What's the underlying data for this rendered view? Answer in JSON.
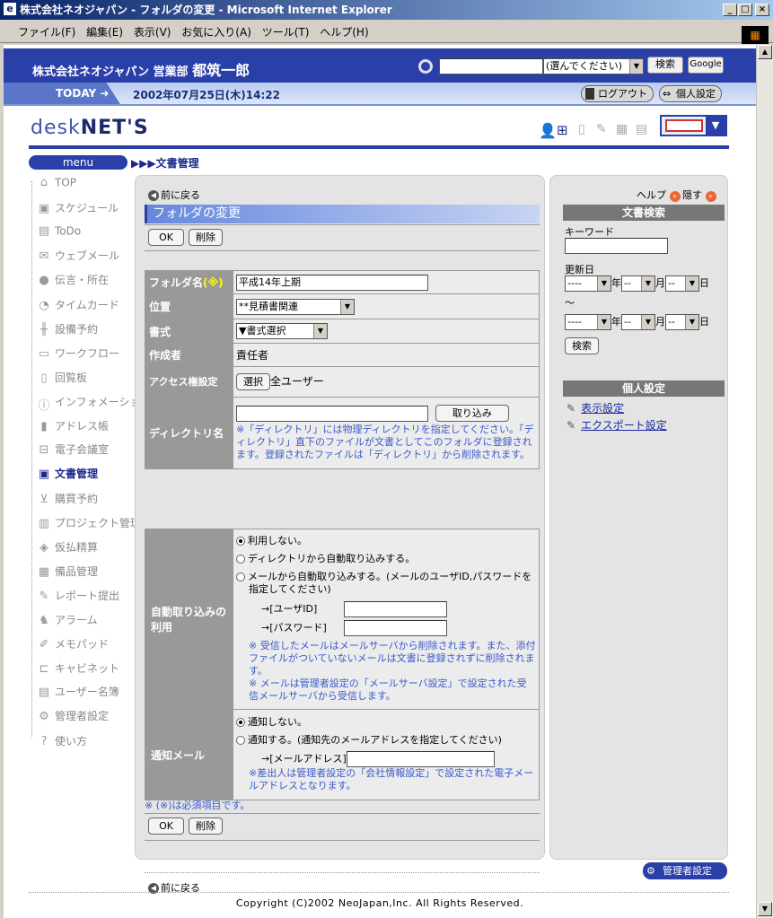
{
  "window": {
    "title": "株式会社ネオジャパン - フォルダの変更 - Microsoft Internet Explorer"
  },
  "menubar": {
    "items": [
      "ファイル(F)",
      "編集(E)",
      "表示(V)",
      "お気に入り(A)",
      "ツール(T)",
      "ヘルプ(H)"
    ]
  },
  "header": {
    "company": "株式会社ネオジャパン 営業部",
    "user": "都筑一郎",
    "search_select": "(選んでください)",
    "search_button": "検索",
    "google_button": "Google"
  },
  "today": {
    "label": "TODAY",
    "datetime": "2002年07月25日(木)14:22",
    "logout": "ログアウト",
    "personal": "個人設定"
  },
  "logo": {
    "thin": "desk",
    "bold": "NET'S"
  },
  "breadcrumb": {
    "menu": "menu",
    "path": "▶▶▶文書管理"
  },
  "nav": {
    "items": [
      "TOP",
      "スケジュール",
      "ToDo",
      "ウェブメール",
      "伝言・所在",
      "タイムカード",
      "設備予約",
      "ワークフロー",
      "回覧板",
      "インフォメーション",
      "アドレス帳",
      "電子会議室",
      "文書管理",
      "購買予約",
      "プロジェクト管理",
      "仮払精算",
      "備品管理",
      "レポート提出",
      "アラーム",
      "メモパッド",
      "キャビネット",
      "ユーザー名簿",
      "管理者設定",
      "使い方"
    ]
  },
  "main": {
    "back": "前に戻る",
    "title": "フォルダの変更",
    "ok": "OK",
    "delete": "削除",
    "rows": {
      "folder_label": "フォルダ名",
      "folder_required": "(※)",
      "folder_value": "平成14年上期",
      "location_label": "位置",
      "location_value": "**見積書関連",
      "format_label": "書式",
      "format_value": "▼書式選択",
      "author_label": "作成者",
      "author_value": "責任者",
      "access_label": "アクセス権設定",
      "access_button": "選択",
      "access_value": "全ユーザー",
      "dir_label": "ディレクトリ名",
      "dir_button": "取り込み",
      "dir_note": "※「ディレクトリ」には物理ディレクトリを指定してください。「ディレクトリ」直下のファイルが文書としてこのフォルダに登録されます。登録されたファイルは「ディレクトリ」から削除されます。"
    },
    "auto": {
      "label": "自動取り込みの利用",
      "opt1": "利用しない。",
      "opt2": "ディレクトリから自動取り込みする。",
      "opt3": "メールから自動取り込みする。(メールのユーザID,パスワードを指定してください)",
      "userid": "→[ユーザID]",
      "password": "→[パスワード]",
      "note1": "※ 受信したメールはメールサーバから削除されます。また、添付ファイルがついていないメールは文書に登録されずに削除されます。",
      "note2": "※ メールは管理者設定の「メールサーバ設定」で設定された受信メールサーバから受信します。"
    },
    "notify": {
      "label": "通知メール",
      "opt1": "通知しない。",
      "opt2": "通知する。(通知先のメールアドレスを指定してください)",
      "address": "→[メールアドレス]",
      "note": "※差出人は管理者設定の「会社情報設定」で設定された電子メールアドレスとなります。"
    },
    "required_note": "※ (※)は必須項目です。"
  },
  "right": {
    "help": "ヘルプ",
    "hide": "隠す",
    "search_header": "文書検索",
    "keyword": "キーワード",
    "updated": "更新日",
    "year": "年",
    "month": "月",
    "day": "日",
    "tilde": "〜",
    "dash": "----",
    "dd": "--",
    "search_button": "検索",
    "personal_header": "個人設定",
    "link1": "表示設定",
    "link2": "エクスポート設定"
  },
  "admin_button": "管理者設定",
  "copyright": "Copyright (C)2002 NeoJapan,Inc. All Rights Reserved."
}
